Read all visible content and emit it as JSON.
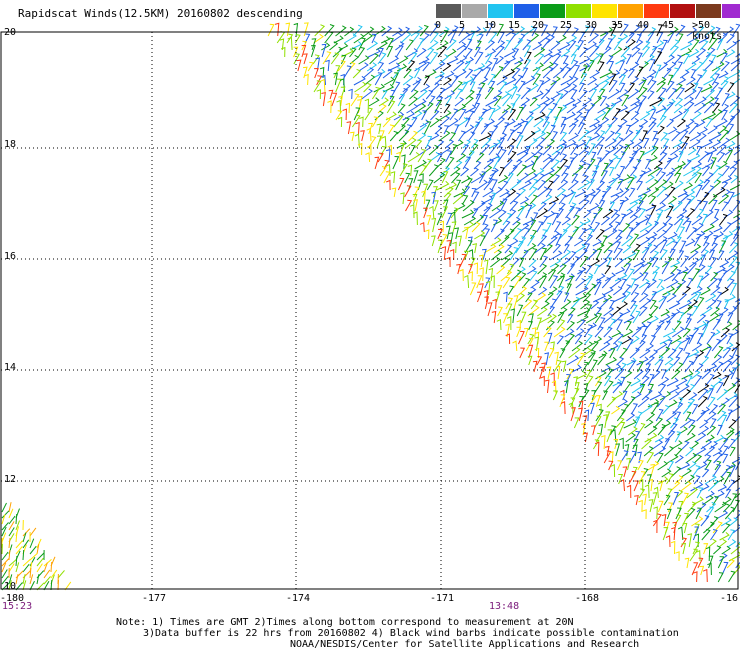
{
  "title": "Rapidscat Winds(12.5KM) 20160802 descending",
  "legend": {
    "labels": [
      "0",
      "5",
      "10",
      "15",
      "20",
      "25",
      "30",
      "35",
      "40",
      "45",
      ">50 knots"
    ],
    "colors": [
      "#5a5a5a",
      "#a9a9a9",
      "#21c4f0",
      "#1f5fe8",
      "#0a9c18",
      "#90e000",
      "#ffe400",
      "#ffa200",
      "#ff3a10",
      "#b21010",
      "#7b3a1e",
      "#a12ad0",
      "#5a007a"
    ]
  },
  "map": {
    "y_ticks": [
      "20",
      "18",
      "16",
      "14",
      "12",
      "10"
    ],
    "x_ticks": [
      "-180",
      "-177",
      "-174",
      "-171",
      "-168",
      "-16"
    ],
    "lat_range": [
      10,
      20
    ],
    "lon_range": [
      -180,
      -165.8
    ],
    "grid": "dotted",
    "times": [
      "15:23",
      "13:48"
    ]
  },
  "notes": {
    "line1": "Note: 1) Times are GMT 2)Times along bottom correspond to measurement at 20N",
    "line2": "3)Data buffer is 22 hrs from 20160802 4) Black wind barbs indicate possible contamination",
    "credit": "NOAA/NESDIS/Center for Satellite Applications and Research"
  }
}
